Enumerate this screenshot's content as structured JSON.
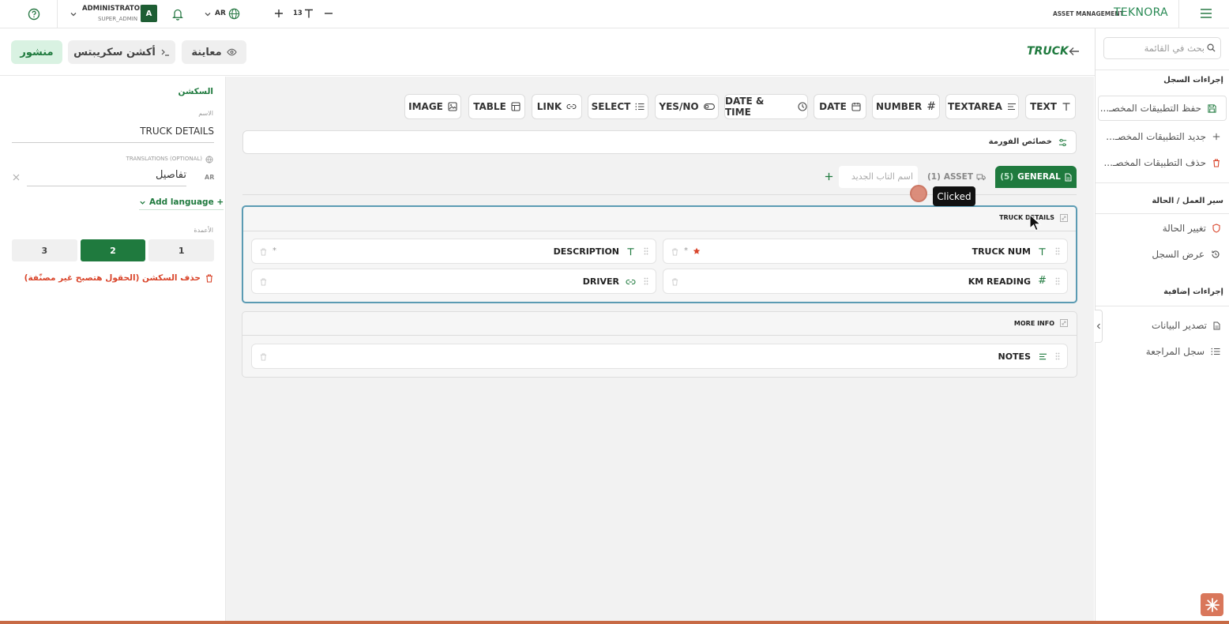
{
  "topbar": {
    "user_name": "ADMINISTRATOR",
    "user_role": "SUPER_ADMIN",
    "avatar_letter": "A",
    "lang": "AR",
    "font_size": "13",
    "brand_sub": "ASSET MANAGEMENT",
    "brand": "TEKNORA"
  },
  "header": {
    "title": "TRUCK",
    "publish_label": "منشور",
    "action_scripts_label": "أكشن سكريبتس",
    "preview_label": "معاينة"
  },
  "left": {
    "section_title": "السكشن",
    "name_label": "الاسم",
    "name_value": "TRUCK DETAILS",
    "translations_label": "TRANSLATIONS (OPTIONAL)",
    "translation_lang": "AR",
    "translation_value": "تفاصيل",
    "add_language": "+ Add language",
    "columns_label": "الأعمدة",
    "columns": [
      "3",
      "2",
      "1"
    ],
    "delete_label": "حذف السكشن (الحقول هتصبح غير مصنّفة)"
  },
  "toolbar": {
    "types": [
      "IMAGE",
      "TABLE",
      "LINK",
      "SELECT",
      "YES/NO",
      "DATE & TIME",
      "DATE",
      "NUMBER",
      "TEXTAREA",
      "TEXT"
    ]
  },
  "form": {
    "properties_label": "خصائص الفورمة",
    "tab_new_placeholder": "اسم التاب الجديد",
    "tab_asset": "ASSET",
    "tab_asset_count": "(1)",
    "tab_general": "GENERAL",
    "tab_general_count": "(5)",
    "tooltip": "Clicked",
    "section1_title": "TRUCK DETAILS",
    "section2_title": "MORE INFO",
    "fields": {
      "description": "DESCRIPTION",
      "truck_num": "TRUCK NUM",
      "driver": "DRIVER",
      "km_reading": "KM READING",
      "notes": "NOTES",
      "req_star": "*"
    }
  },
  "right": {
    "search_placeholder": "بحث في القائمة",
    "record_actions": "إجراءات السجل",
    "save_custom": "حفظ التطبيقات المخصـ...",
    "new_custom": "جديد التطبيقات المخصـ...",
    "delete_custom": "حذف التطبيقات المخصـ...",
    "workflow": "سير العمل / الحالة",
    "change_status": "تغيير الحالة",
    "view_record": "عرض السجل",
    "extra_actions": "إجراءات إضافية",
    "export_data": "تصدير البيانات",
    "audit_log": "سجل المراجعة"
  },
  "colors": {
    "primary": "#1f7a3e",
    "danger": "#d9452b",
    "focus": "#5b9bb3"
  }
}
